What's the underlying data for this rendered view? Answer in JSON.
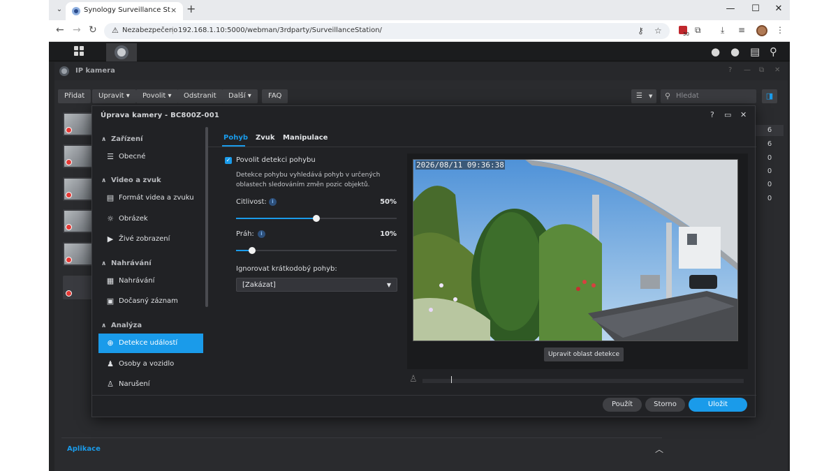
{
  "browser": {
    "tab_title": "Synology Surveillance Station -",
    "tab_close": "×",
    "new_tab": "+",
    "security_label": "Nezabezpečeno",
    "url": "192.168.1.10:5000/webman/3rdparty/SurveillanceStation/",
    "extension_badge": "30",
    "window_controls": [
      "—",
      "☐",
      "✕"
    ]
  },
  "window": {
    "title": "IP kamera"
  },
  "toolbar": {
    "add": "Přidat",
    "edit": "Upravit ▾",
    "enable": "Povolit ▾",
    "remove": "Odstranit",
    "more": "Další ▾",
    "faq": "FAQ",
    "search_placeholder": "Hledat"
  },
  "camera_counts": [
    "6",
    "6",
    "0",
    "0",
    "0",
    "0"
  ],
  "apps_section": "Aplikace",
  "dialog": {
    "title": "Úprava kamery - BC800Z-001",
    "sidebar": {
      "groups": [
        {
          "label": "Zařízení",
          "items": [
            {
              "label": "Obecné",
              "icon": "list-icon"
            }
          ]
        },
        {
          "label": "Video a zvuk",
          "items": [
            {
              "label": "Formát videa a zvuku",
              "icon": "film-icon"
            },
            {
              "label": "Obrázek",
              "icon": "sun-icon"
            },
            {
              "label": "Živé zobrazení",
              "icon": "play-icon"
            }
          ]
        },
        {
          "label": "Nahrávání",
          "items": [
            {
              "label": "Nahrávání",
              "icon": "calendar-icon"
            },
            {
              "label": "Dočasný záznam",
              "icon": "sd-icon"
            }
          ]
        },
        {
          "label": "Analýza",
          "items": [
            {
              "label": "Detekce událostí",
              "icon": "target-icon",
              "active": true
            },
            {
              "label": "Osoby a vozidlo",
              "icon": "people-icon"
            },
            {
              "label": "Narušení",
              "icon": "walker-icon"
            }
          ]
        }
      ]
    },
    "tabs": [
      "Pohyb",
      "Zvuk",
      "Manipulace"
    ],
    "active_tab": "Pohyb",
    "motion": {
      "enable_label": "Povolit detekci pohybu",
      "enabled": true,
      "description": "Detekce pohybu vyhledává pohyb v určených oblastech sledováním změn pozic objektů.",
      "sensitivity_label": "Citlivost:",
      "sensitivity_value": "50%",
      "sensitivity_fraction": 0.5,
      "threshold_label": "Práh:",
      "threshold_value": "10%",
      "threshold_fraction": 0.1,
      "ignore_label": "Ignorovat krátkodobý pohyb:",
      "ignore_value": "[Zakázat]"
    },
    "preview": {
      "timestamp": "2026/08/11 09:36:38",
      "edit_area_button": "Upravit oblast detekce"
    },
    "buttons": {
      "apply": "Použít",
      "cancel": "Storno",
      "save": "Uložit"
    }
  },
  "colors": {
    "accent": "#1a9bea",
    "window_bg": "#2a2b2e",
    "dialog_bg": "#212225"
  }
}
